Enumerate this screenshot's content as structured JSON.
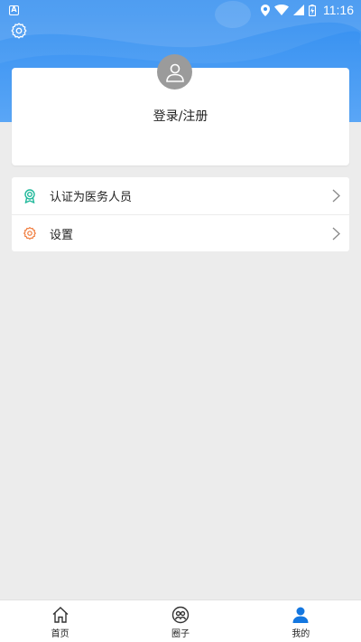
{
  "status_bar": {
    "left_icon": "A",
    "time": "11:16"
  },
  "profile": {
    "login_label": "登录/注册"
  },
  "menu": [
    {
      "label": "认证为医务人员",
      "icon": "badge-icon",
      "color": "#1fb89a"
    },
    {
      "label": "设置",
      "icon": "gear-icon",
      "color": "#f07a3a"
    }
  ],
  "tabbar": [
    {
      "label": "首页",
      "icon": "home-icon",
      "active": false
    },
    {
      "label": "圈子",
      "icon": "circle-icon",
      "active": false
    },
    {
      "label": "我的",
      "icon": "user-icon",
      "active": true
    }
  ],
  "colors": {
    "header": "#2f8cf0",
    "active_tab": "#1477e0"
  }
}
